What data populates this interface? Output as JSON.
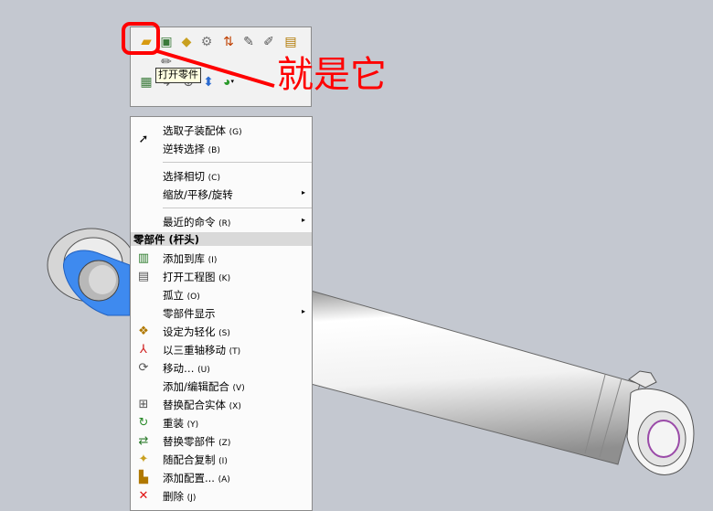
{
  "toolbar": {
    "tooltip": "打开零件",
    "icons": [
      "open-part-icon",
      "component-icon",
      "assembly-icon",
      "mates-icon",
      "sort-icon",
      "paperclip-icon",
      "edit-sketch-icon",
      "properties-icon",
      "edit-part-icon",
      "part-icon",
      "sketch-icon",
      "zoom-icon",
      "normal-icon",
      "appearance-icon"
    ]
  },
  "annotation": {
    "text": "就是它",
    "color": "#ff0000"
  },
  "menu": {
    "items_top": [
      {
        "label": "选取子装配体",
        "shortcut": "(G)"
      },
      {
        "label": "逆转选择",
        "shortcut": "(B)"
      },
      {
        "label": "选择相切",
        "shortcut": "(C)"
      },
      {
        "label": "缩放/平移/旋转",
        "arrow": "▸"
      },
      {
        "label": "最近的命令",
        "shortcut": "(R)",
        "arrow": "▸"
      }
    ],
    "section_header": "零部件 (杆头)",
    "items_component": [
      {
        "label": "添加到库",
        "shortcut": "(I)"
      },
      {
        "label": "打开工程图",
        "shortcut": "(K)"
      },
      {
        "label": "孤立",
        "shortcut": "(O)"
      },
      {
        "label": "零部件显示",
        "arrow": "▸"
      },
      {
        "label": "设定为轻化",
        "shortcut": "(S)"
      },
      {
        "label": "以三重轴移动",
        "shortcut": "(T)"
      },
      {
        "label": "移动…",
        "shortcut": "(U)"
      },
      {
        "label": "添加/编辑配合",
        "shortcut": "(V)"
      },
      {
        "label": "替换配合实体",
        "shortcut": "(X)"
      },
      {
        "label": "重装",
        "shortcut": "(Y)"
      },
      {
        "label": "替换零部件",
        "shortcut": "(Z)"
      },
      {
        "label": "随配合复制",
        "shortcut": "(I)"
      },
      {
        "label": "添加配置...",
        "shortcut": "(A)"
      },
      {
        "label": "删除",
        "shortcut": "(J)"
      }
    ]
  },
  "colors": {
    "viewport": "#c4c8d0",
    "selected_face": "#3e8aef",
    "highlight_ring": "#ff0000"
  }
}
